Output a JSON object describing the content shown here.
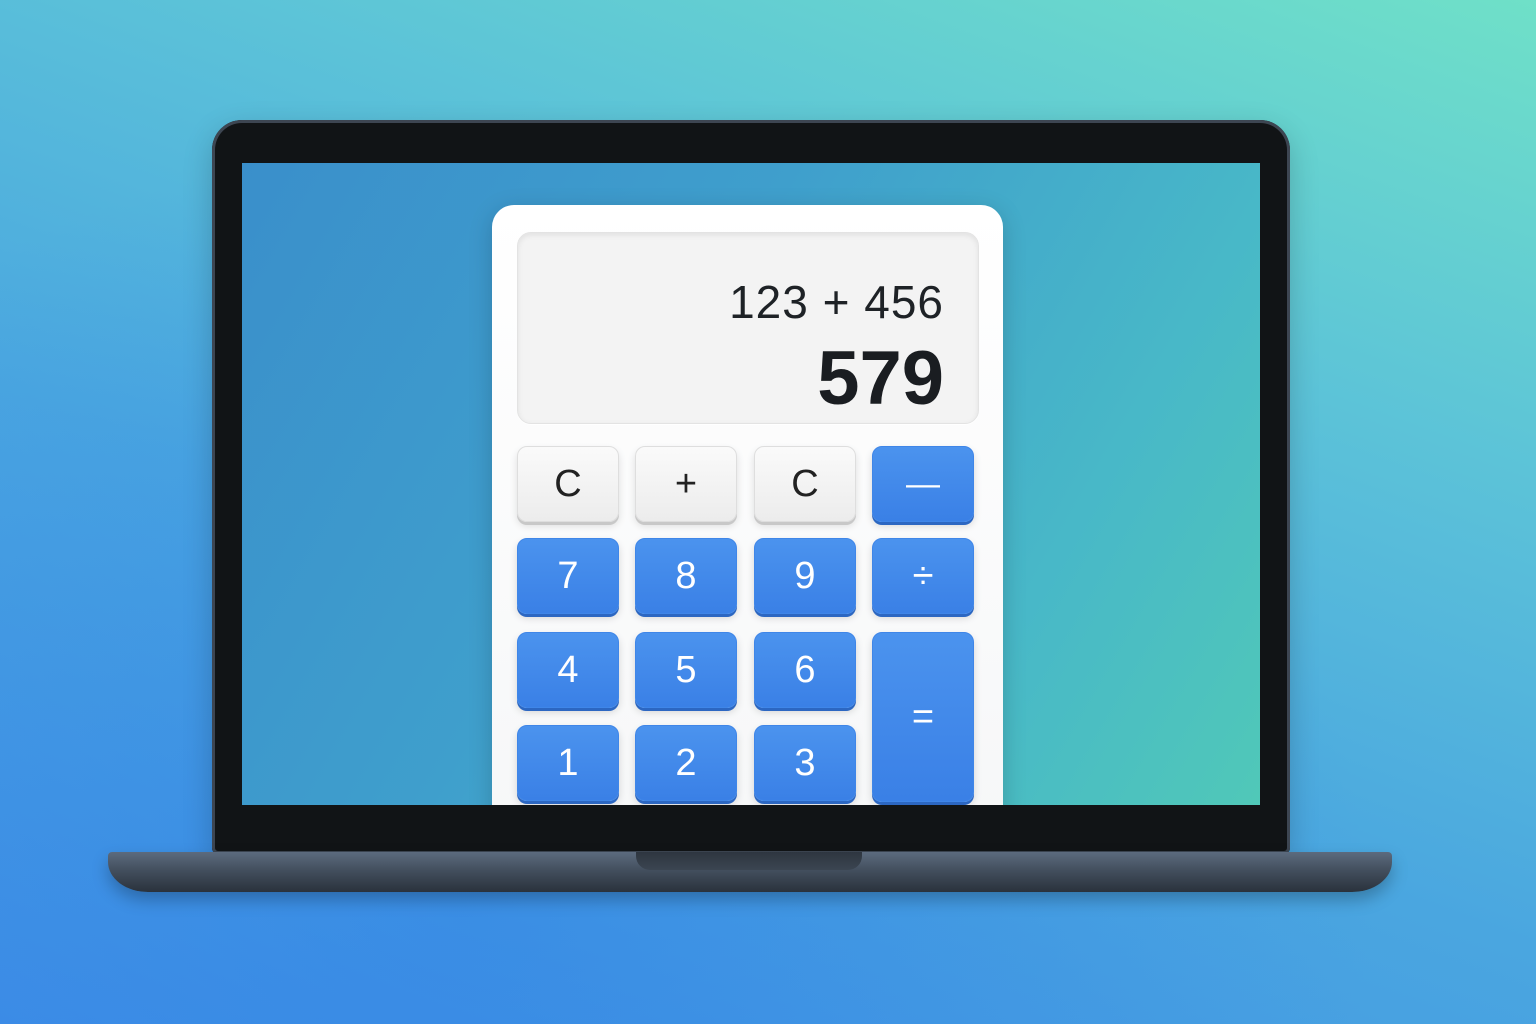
{
  "display": {
    "expression": "123 + 456",
    "result": "579"
  },
  "keys": {
    "row1": [
      {
        "label": "C"
      },
      {
        "label": "+"
      },
      {
        "label": "C"
      },
      {
        "label": "—"
      }
    ],
    "row2": [
      {
        "label": "7"
      },
      {
        "label": "8"
      },
      {
        "label": "9"
      },
      {
        "label": "÷"
      }
    ],
    "row3": [
      {
        "label": "4"
      },
      {
        "label": "5"
      },
      {
        "label": "6"
      },
      {
        "label": "="
      }
    ],
    "row4": [
      {
        "label": "1"
      },
      {
        "label": "2"
      },
      {
        "label": "3"
      }
    ]
  },
  "colors": {
    "key_blue": "#3a80e6",
    "key_light": "#f2f2f2",
    "laptop_bezel": "#111416",
    "background_start": "#3f8fe6",
    "background_end": "#6fe0c8"
  }
}
